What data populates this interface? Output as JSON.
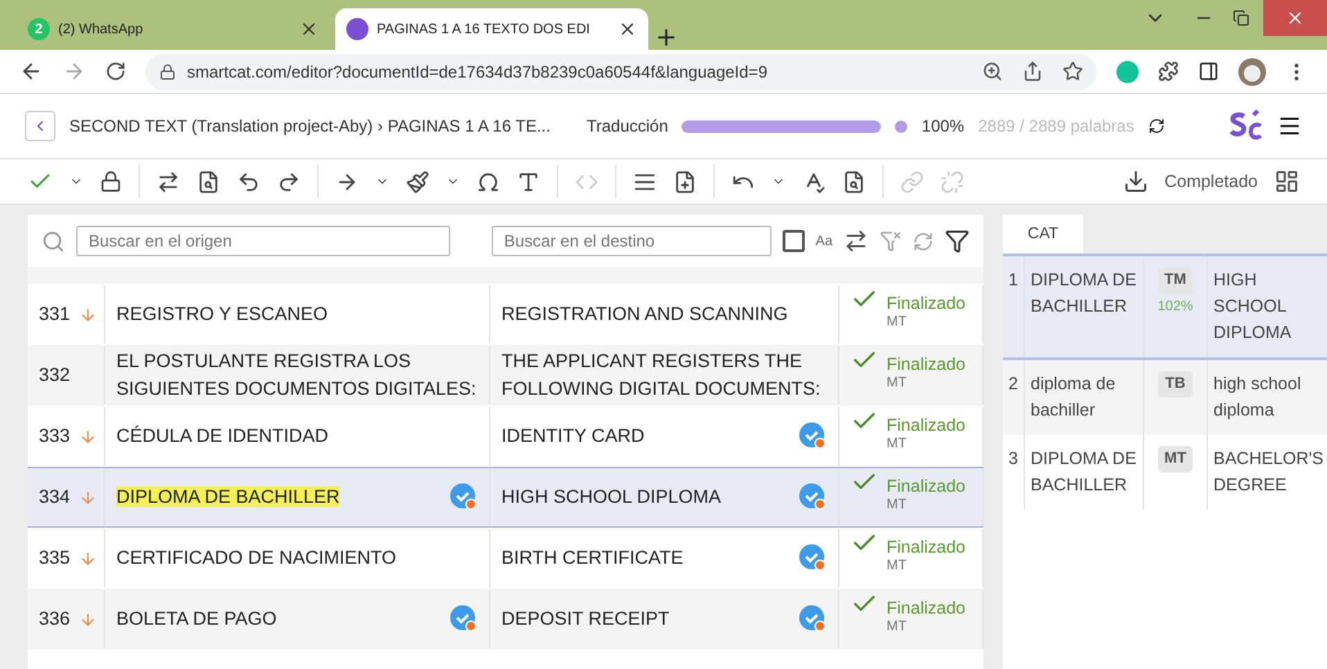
{
  "browser": {
    "tabs": [
      {
        "title": "(2) WhatsApp",
        "badge": "2",
        "kind": "whatsapp",
        "selected": false
      },
      {
        "title": "PAGINAS 1 A 16 TEXTO DOS EDI",
        "kind": "smartcat",
        "selected": true
      }
    ],
    "url": "smartcat.com/editor?documentId=de17634d37b8239c0a60544f&languageId=9"
  },
  "header": {
    "breadcrumb": "SECOND TEXT (Translation project-Aby) › PAGINAS 1 A 16 TE...",
    "stage": "Traducción",
    "level": 1,
    "percent": "100%",
    "words": "2889 / 2889 palabras"
  },
  "toolbar": {
    "status": "Completado"
  },
  "search": {
    "source_placeholder": "Buscar en el origen",
    "target_placeholder": "Buscar en el destino",
    "case_label": "Aa",
    "case_checked": false
  },
  "segments": [
    {
      "number": "331",
      "arrow": true,
      "source": "REGISTRO Y ESCANEO",
      "target": "REGISTRATION AND SCANNING",
      "source_badge": false,
      "target_badge": false,
      "status": "Finalizado",
      "origin": "MT",
      "selected": false,
      "highlight": false
    },
    {
      "number": "332",
      "arrow": false,
      "source": "EL POSTULANTE REGISTRA LOS SIGUIENTES DOCUMENTOS DIGITALES:",
      "target": "THE APPLICANT REGISTERS THE FOLLOWING DIGITAL DOCUMENTS:",
      "source_badge": false,
      "target_badge": false,
      "status": "Finalizado",
      "origin": "MT",
      "selected": false,
      "highlight": false
    },
    {
      "number": "333",
      "arrow": true,
      "source": "CÉDULA DE IDENTIDAD",
      "target": "IDENTITY CARD",
      "source_badge": false,
      "target_badge": true,
      "status": "Finalizado",
      "origin": "MT",
      "selected": false,
      "highlight": false
    },
    {
      "number": "334",
      "arrow": true,
      "source": "DIPLOMA DE BACHILLER",
      "target": "HIGH SCHOOL DIPLOMA",
      "source_badge": true,
      "target_badge": true,
      "status": "Finalizado",
      "origin": "MT",
      "selected": true,
      "highlight": true
    },
    {
      "number": "335",
      "arrow": true,
      "source": "CERTIFICADO DE NACIMIENTO",
      "target": "BIRTH CERTIFICATE",
      "source_badge": false,
      "target_badge": true,
      "status": "Finalizado",
      "origin": "MT",
      "selected": false,
      "highlight": false
    },
    {
      "number": "336",
      "arrow": true,
      "source": "BOLETA DE PAGO",
      "target": "DEPOSIT RECEIPT",
      "source_badge": true,
      "target_badge": true,
      "status": "Finalizado",
      "origin": "MT",
      "selected": false,
      "highlight": false
    }
  ],
  "cat": {
    "tab": "CAT",
    "matches": [
      {
        "index": "1",
        "source": "DIPLOMA DE BACHILLER",
        "type": "TM",
        "percent": "102%",
        "target": "HIGH SCHOOL DIPLOMA",
        "selected": true
      },
      {
        "index": "2",
        "source": "diploma de bachiller",
        "type": "TB",
        "target": "high school diploma",
        "selected": false
      },
      {
        "index": "3",
        "source": "DIPLOMA DE BACHILLER",
        "type": "MT",
        "target": "BACHELOR'S DEGREE",
        "selected": false
      }
    ]
  }
}
